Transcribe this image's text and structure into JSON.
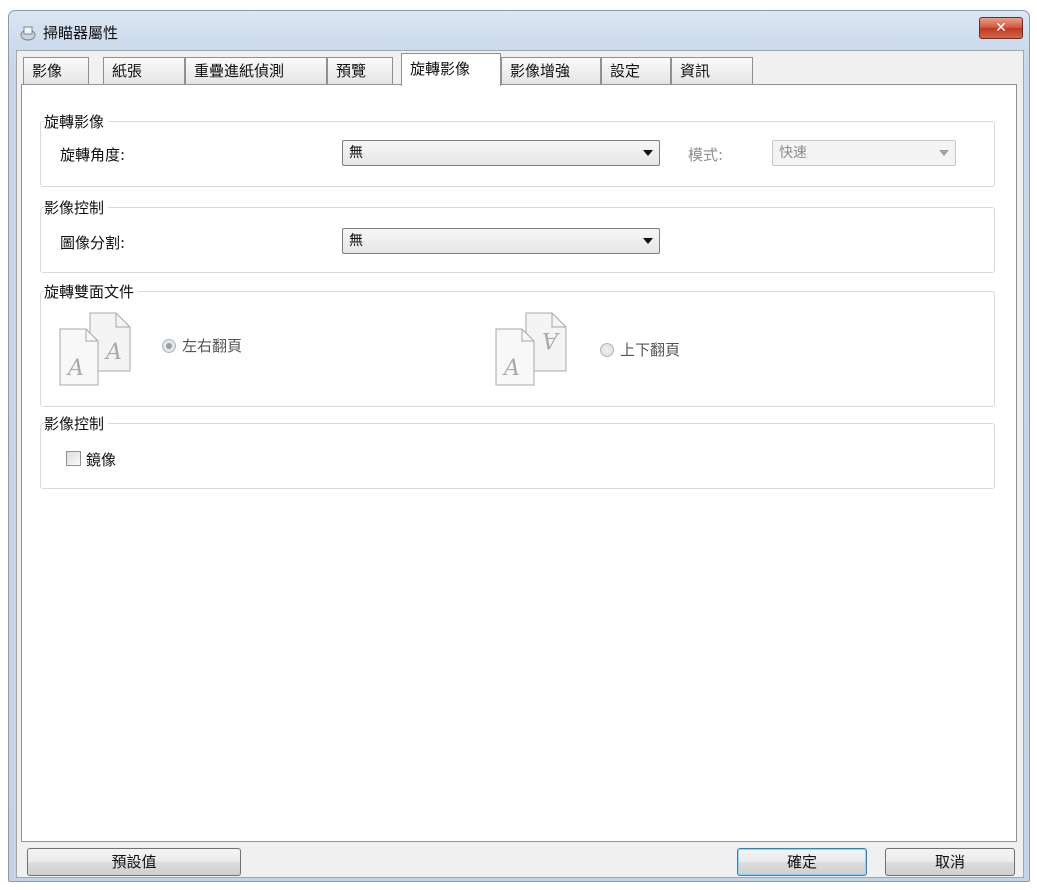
{
  "window": {
    "title": "掃瞄器屬性"
  },
  "tabs": [
    {
      "label": "影像"
    },
    {
      "label": "紙張"
    },
    {
      "label": "重疊進紙偵測"
    },
    {
      "label": "預覽"
    },
    {
      "label": "旋轉影像",
      "active": true
    },
    {
      "label": "影像增強"
    },
    {
      "label": "設定"
    },
    {
      "label": "資訊"
    }
  ],
  "rotate_group": {
    "title": "旋轉影像",
    "angle_label": "旋轉角度:",
    "angle_value": "無",
    "mode_label": "模式:",
    "mode_value": "快速"
  },
  "image_control_group": {
    "title": "影像控制",
    "split_label": "圖像分割:",
    "split_value": "無"
  },
  "duplex_group": {
    "title": "旋轉雙面文件",
    "option_left_right": "左右翻頁",
    "option_top_bottom": "上下翻頁",
    "selected": "左右翻頁",
    "page_glyph": "A"
  },
  "mirror_group": {
    "title": "影像控制",
    "mirror_label": "鏡像",
    "mirror_checked": false
  },
  "buttons": {
    "defaults": "預設值",
    "ok": "確定",
    "cancel": "取消"
  },
  "colors": {
    "close_button": "#c9462f",
    "window_frame": "#c8d6e9",
    "default_button_border": "#3c7fb1"
  }
}
